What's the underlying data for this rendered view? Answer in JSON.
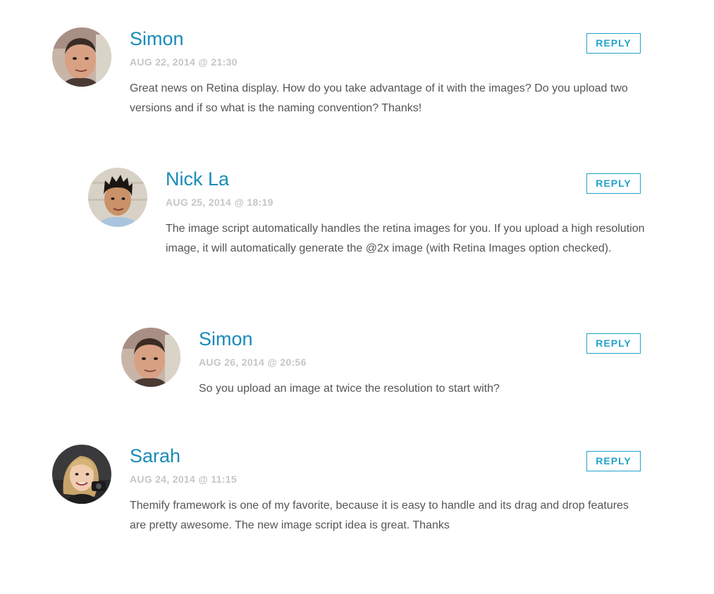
{
  "comments": [
    {
      "author": "Simon",
      "date": "AUG 22, 2014 @ 21:30",
      "text": "Great news on Retina display. How do you take advantage of it with the images? Do you upload two versions and if so what is the naming convention? Thanks!",
      "reply_label": "REPLY",
      "avatar": "avatar-man-short-hair"
    },
    {
      "author": "Nick La",
      "date": "AUG 25, 2014 @ 18:19",
      "text": "The image script automatically handles the retina images for you. If you upload a high resolution image, it will automatically generate the @2x image (with Retina Images option checked).",
      "reply_label": "REPLY",
      "avatar": "avatar-man-spiky-hair"
    },
    {
      "author": "Simon",
      "date": "AUG 26, 2014 @ 20:56",
      "text": "So you upload an image at twice the resolution to start with?",
      "reply_label": "REPLY",
      "avatar": "avatar-man-short-hair"
    },
    {
      "author": "Sarah",
      "date": "AUG 24, 2014 @ 11:15",
      "text": "Themify framework is one of my favorite, because it is easy to handle and its drag and drop features are pretty awesome. The new image script idea is great. Thanks",
      "reply_label": "REPLY",
      "avatar": "avatar-woman-blonde"
    }
  ],
  "colors": {
    "author_link": "#1a8bb8",
    "meta": "#c6c6c6",
    "body": "#555555",
    "reply_accent": "#22a3cb"
  }
}
